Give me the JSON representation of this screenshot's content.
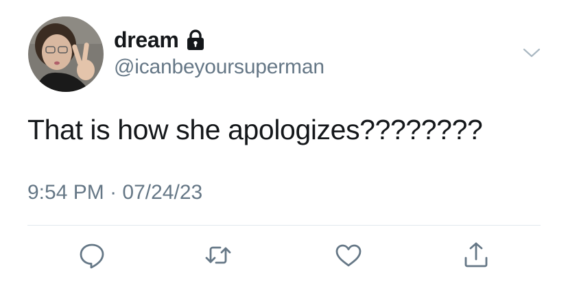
{
  "user": {
    "display_name": "dream",
    "handle": "@icanbeyoursuperman",
    "protected_icon": "lock-icon",
    "avatar": "profile-photo"
  },
  "tweet": {
    "text": "That is how she apologizes????????",
    "time": "9:54 PM",
    "separator": " · ",
    "date": "07/24/23"
  },
  "actions": {
    "reply_icon": "reply-icon",
    "retweet_icon": "retweet-icon",
    "like_icon": "heart-icon",
    "share_icon": "share-icon",
    "menu_icon": "chevron-down-icon"
  },
  "colors": {
    "text": "#14171a",
    "secondary": "#657786",
    "icon": "#657786",
    "divider": "#e1e8ed"
  }
}
